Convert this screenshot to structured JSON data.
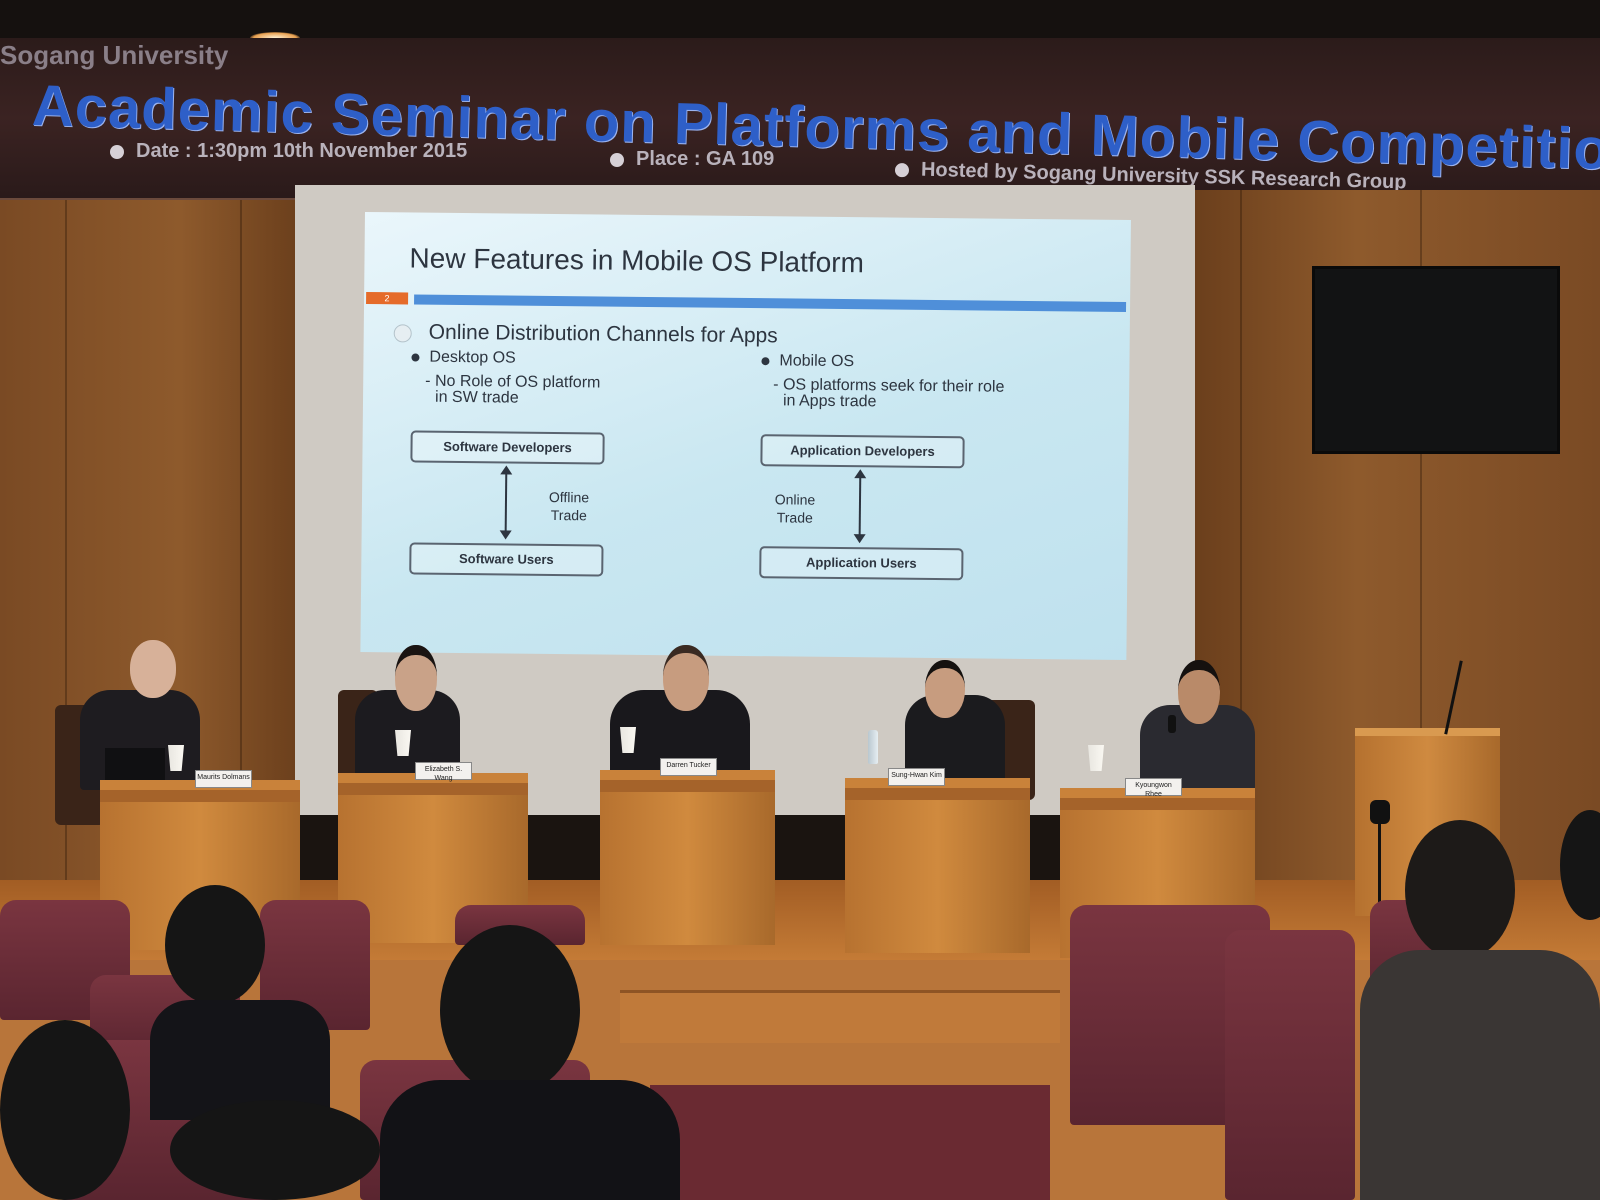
{
  "banner": {
    "university": "Sogang University",
    "title": "Academic Seminar on Platforms and Mobile Competition",
    "date": "Date : 1:30pm 10th November 2015",
    "place": "Place : GA 109",
    "host": "Hosted by Sogang University SSK Research Group"
  },
  "slide": {
    "title": "New Features in Mobile OS Platform",
    "page_number": "2",
    "heading": "Online Distribution Channels for Apps",
    "left": {
      "bullet": "Desktop OS",
      "sub_line1": "- No Role of OS platform",
      "sub_line2": "in SW trade",
      "top_box": "Software Developers",
      "bottom_box": "Software Users",
      "arrow_label_1": "Offline",
      "arrow_label_2": "Trade"
    },
    "right": {
      "bullet": "Mobile OS",
      "sub_line1": "- OS platforms seek for their role",
      "sub_line2": "in Apps trade",
      "top_box": "Application Developers",
      "bottom_box": "Application Users",
      "arrow_label_1": "Online",
      "arrow_label_2": "Trade"
    }
  },
  "nameplates": {
    "p1": "Maurits Dolmans",
    "p2": "Elizabeth S. Wang",
    "p3": "Darren Tucker",
    "p4": "Sung-Hwan Kim",
    "p5": "Kyoungwon Rhee"
  },
  "colors": {
    "banner_title": "#2e5fc8",
    "slide_accent": "#4f8fd9",
    "slide_number_bg": "#e56b2a",
    "wood": "#c9823a",
    "seats": "#7a3540"
  }
}
